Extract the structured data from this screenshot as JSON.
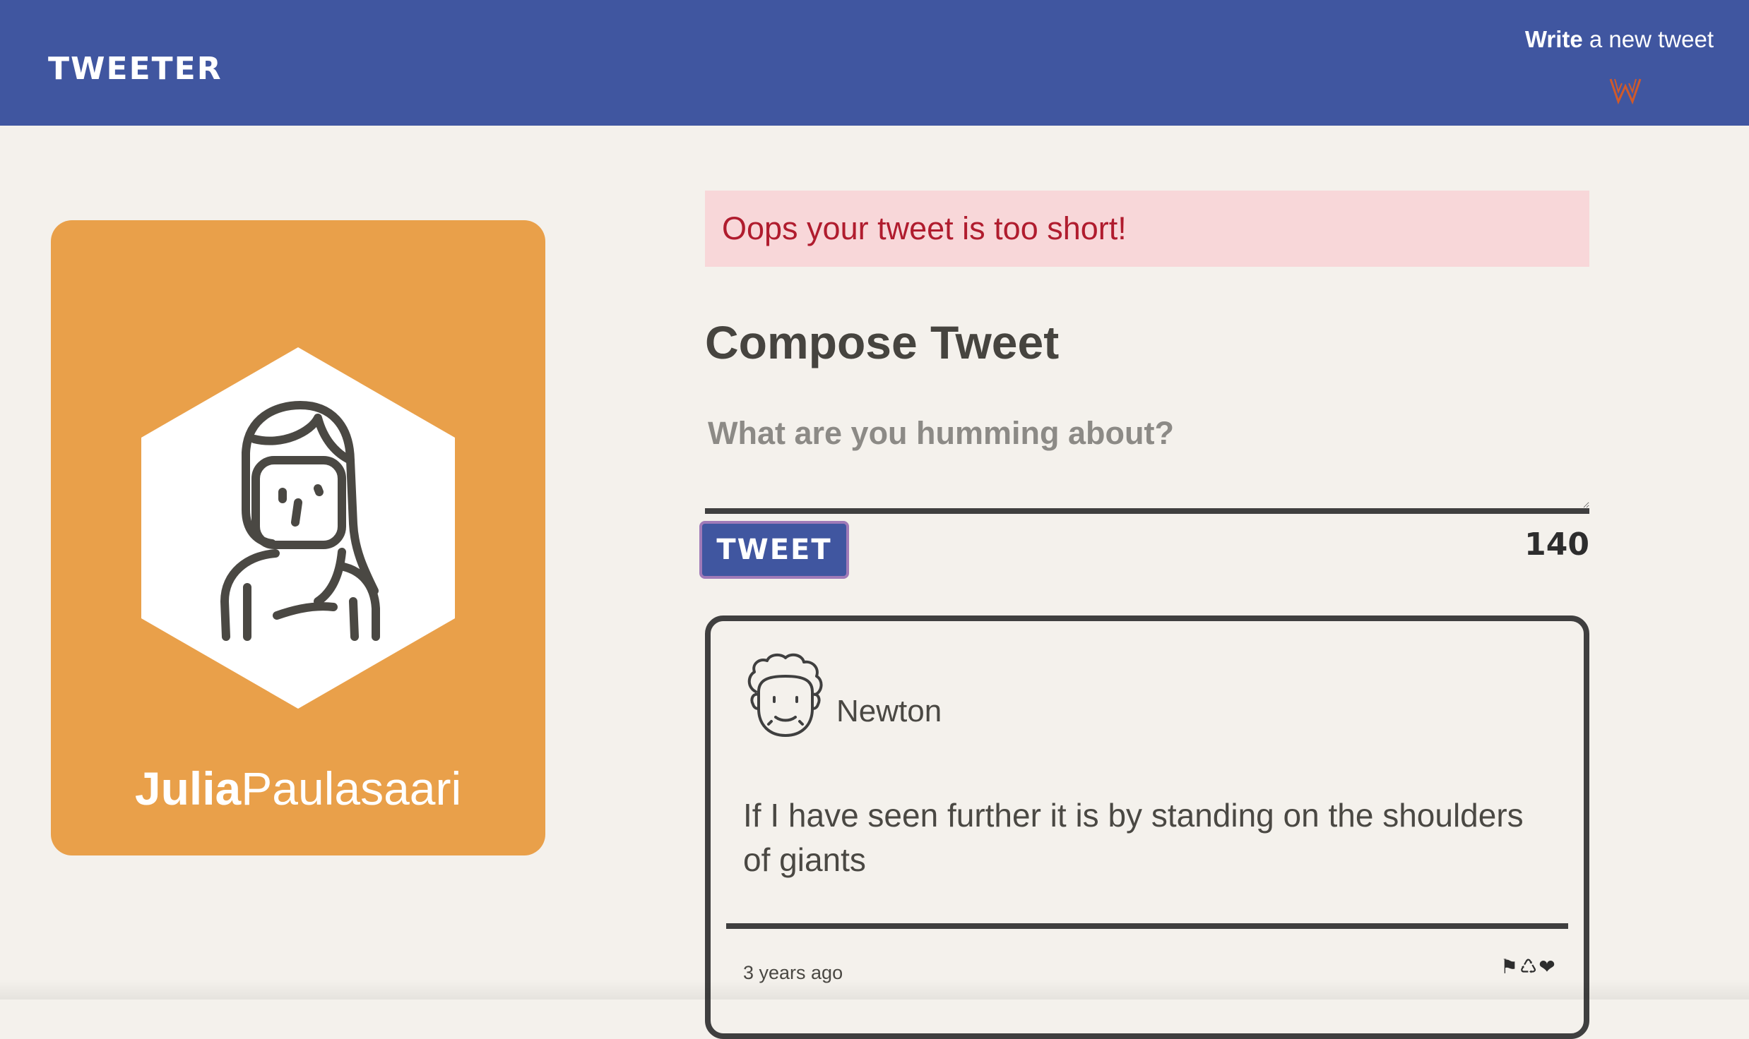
{
  "navbar": {
    "brand": "TWEETER",
    "compose_toggle": {
      "bold_text": "Write",
      "rest_text": " a new tweet",
      "icon": "chevron-double-down-icon",
      "icon_color": "#d05a2a"
    },
    "background": "#4056a0"
  },
  "profile": {
    "first_name": "Julia",
    "last_name": "Paulasaari",
    "card_color": "#e9a04a",
    "avatar_icon": "woman-avatar-icon"
  },
  "error": {
    "message": "Oops your tweet is too short!"
  },
  "compose": {
    "title": "Compose Tweet",
    "placeholder": "What are you humming about?",
    "value": "",
    "button_label": "TWEET",
    "counter": "140"
  },
  "tweets": [
    {
      "author": "Newton",
      "avatar_icon": "newton-avatar-icon",
      "text": "If I have seen further it is by standing on the shoulders of giants",
      "time": "3 years ago",
      "actions": {
        "flag": "⚑",
        "retweet": "♺",
        "like": "❤"
      }
    }
  ]
}
